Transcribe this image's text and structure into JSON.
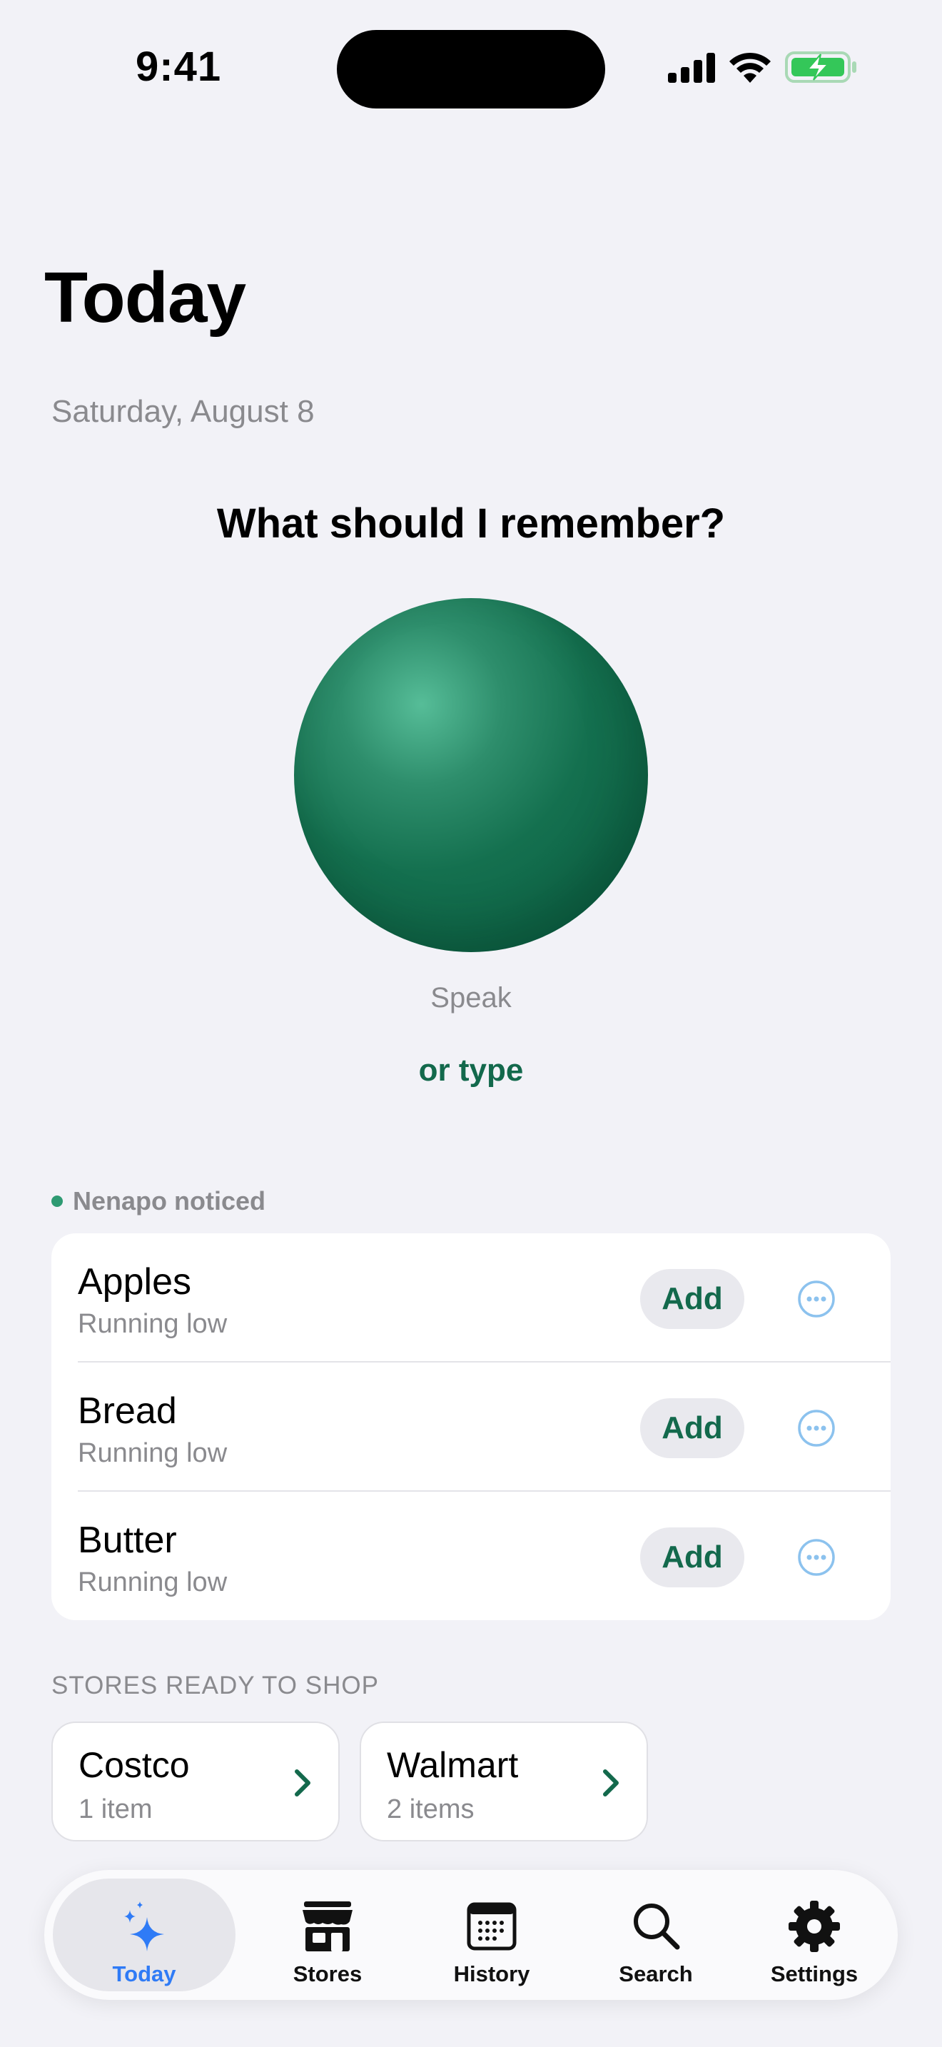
{
  "status_bar": {
    "time": "9:41"
  },
  "page": {
    "title": "Today",
    "date": "Saturday, August 8",
    "prompt": "What should I remember?",
    "speak_label": "Speak",
    "type_link": "or type"
  },
  "noticed": {
    "label": "Nenapo noticed",
    "items": [
      {
        "name": "Apples",
        "status": "Running low",
        "action": "Add"
      },
      {
        "name": "Bread",
        "status": "Running low",
        "action": "Add"
      },
      {
        "name": "Butter",
        "status": "Running low",
        "action": "Add"
      }
    ]
  },
  "stores": {
    "label": "STORES READY TO SHOP",
    "items": [
      {
        "name": "Costco",
        "count": "1 item"
      },
      {
        "name": "Walmart",
        "count": "2 items"
      }
    ]
  },
  "tabbar": {
    "active": "Today",
    "tabs": [
      {
        "label": "Today",
        "icon": "sparkles-icon"
      },
      {
        "label": "Stores",
        "icon": "storefront-icon"
      },
      {
        "label": "History",
        "icon": "calendar-icon"
      },
      {
        "label": "Search",
        "icon": "search-icon"
      },
      {
        "label": "Settings",
        "icon": "gear-icon"
      }
    ]
  },
  "colors": {
    "accent_green": "#13694C",
    "orb_green": "#14704F",
    "active_tab_blue": "#2F7BF6",
    "more_icon_blue": "#8CC2EE",
    "battery_green": "#34C759"
  }
}
